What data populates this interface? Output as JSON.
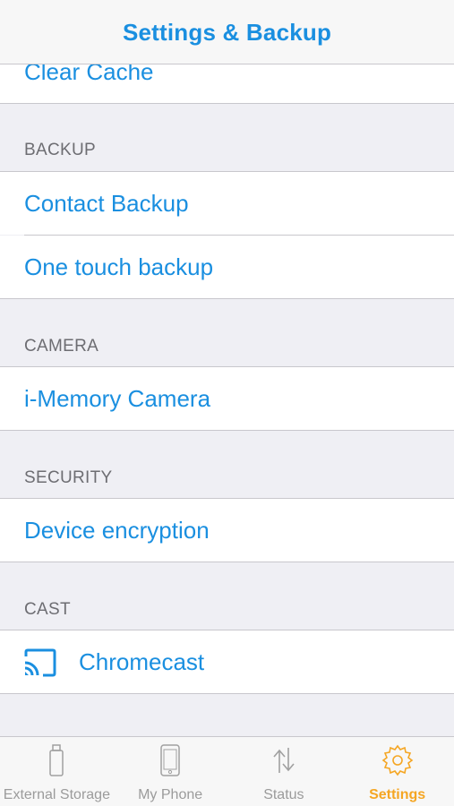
{
  "header": {
    "title": "Settings & Backup"
  },
  "rows": {
    "clear_cache": "Clear Cache",
    "contact_backup": "Contact Backup",
    "one_touch_backup": "One touch backup",
    "memory_camera": "i-Memory Camera",
    "device_encryption": "Device encryption",
    "chromecast": "Chromecast"
  },
  "sections": {
    "backup": "BACKUP",
    "camera": "CAMERA",
    "security": "SECURITY",
    "cast": "CAST"
  },
  "tabs": [
    {
      "label": "External Storage",
      "icon": "usb-drive-icon",
      "active": false
    },
    {
      "label": "My Phone",
      "icon": "phone-icon",
      "active": false
    },
    {
      "label": "Status",
      "icon": "transfer-arrows-icon",
      "active": false
    },
    {
      "label": "Settings",
      "icon": "gear-icon",
      "active": true
    }
  ],
  "colors": {
    "accent_blue": "#1a8fe0",
    "active_orange": "#f5a623",
    "inactive_gray": "#9b9b9b",
    "group_background": "#efeff4"
  }
}
